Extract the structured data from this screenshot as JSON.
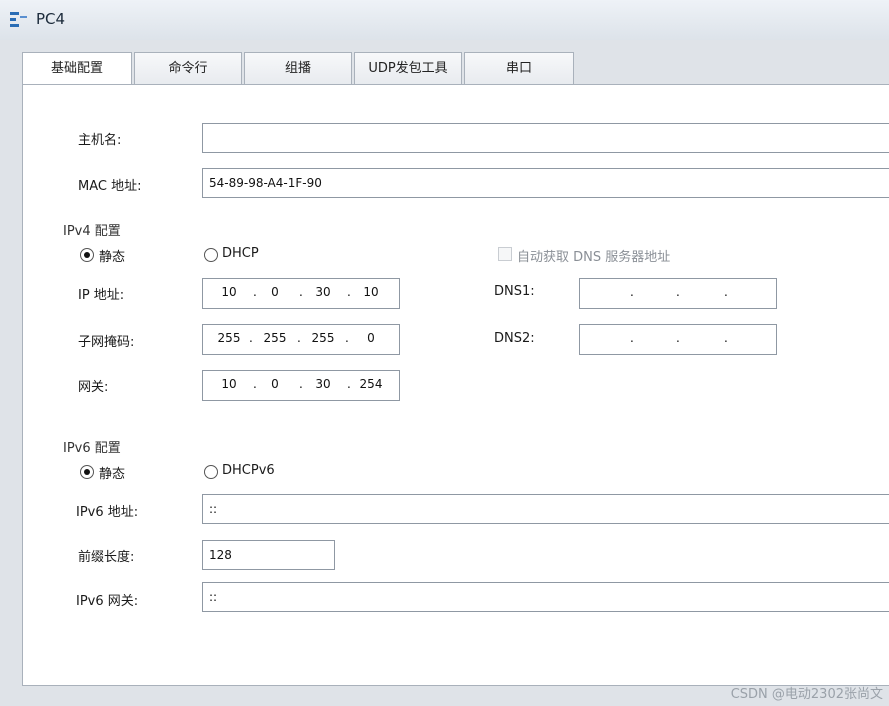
{
  "window": {
    "title": "PC4",
    "icon": "network-pc-icon"
  },
  "tabs": [
    {
      "label": "基础配置",
      "active": true
    },
    {
      "label": "命令行",
      "active": false
    },
    {
      "label": "组播",
      "active": false
    },
    {
      "label": "UDP发包工具",
      "active": false
    },
    {
      "label": "串口",
      "active": false
    }
  ],
  "basic": {
    "hostname_label": "主机名:",
    "hostname_value": "",
    "mac_label": "MAC 地址:",
    "mac_value": "54-89-98-A4-1F-90"
  },
  "ipv4": {
    "section_label": "IPv4 配置",
    "static_label": "静态",
    "dhcp_label": "DHCP",
    "mode": "static",
    "auto_dns_label": "自动获取 DNS 服务器地址",
    "auto_dns_checked": false,
    "ip_label": "IP 地址:",
    "ip": [
      "10",
      "0",
      "30",
      "10"
    ],
    "mask_label": "子网掩码:",
    "mask": [
      "255",
      "255",
      "255",
      "0"
    ],
    "gw_label": "网关:",
    "gw": [
      "10",
      "0",
      "30",
      "254"
    ],
    "dns1_label": "DNS1:",
    "dns1": [
      "",
      "",
      "",
      ""
    ],
    "dns2_label": "DNS2:",
    "dns2": [
      "",
      "",
      "",
      ""
    ]
  },
  "ipv6": {
    "section_label": "IPv6 配置",
    "static_label": "静态",
    "dhcpv6_label": "DHCPv6",
    "mode": "static",
    "addr_label": "IPv6 地址:",
    "addr_value": "::",
    "prefix_label": "前缀长度:",
    "prefix_value": "128",
    "gw_label": "IPv6 网关:",
    "gw_value": "::"
  },
  "watermark": "CSDN @电动2302张尚文"
}
